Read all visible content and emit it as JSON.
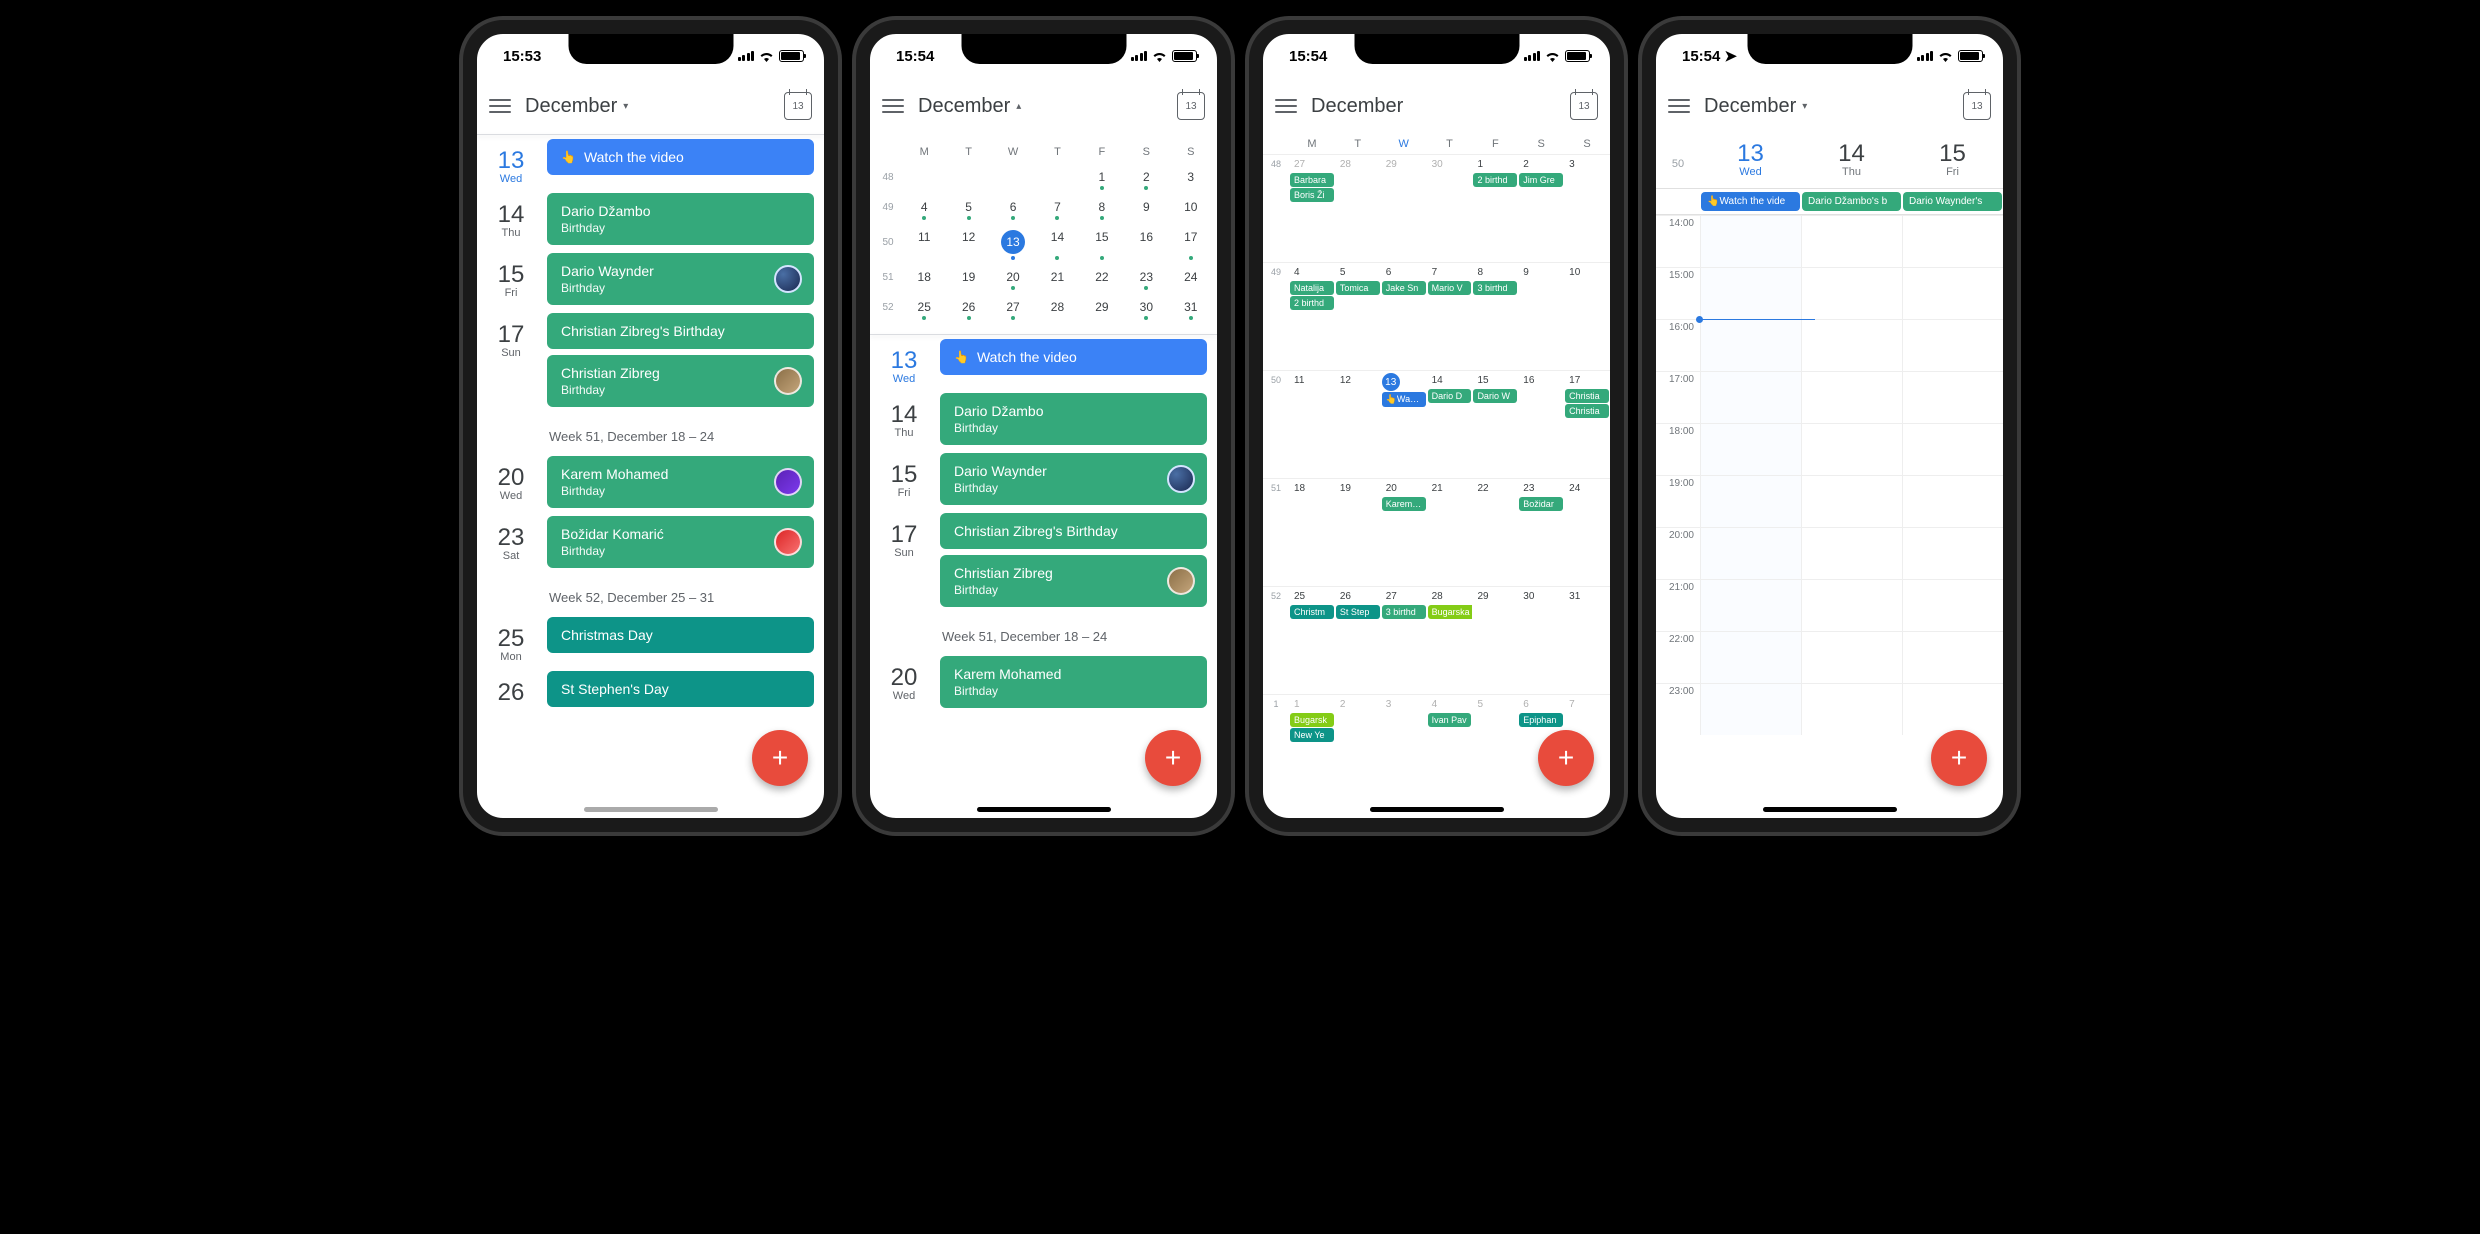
{
  "colors": {
    "accent_blue": "#2b79e0",
    "event_green": "#34a97b",
    "event_teal": "#0d9488",
    "fab": "#e84b3c"
  },
  "p1": {
    "time": "15:53",
    "month": "December",
    "arrow": "▾",
    "today_num": "13",
    "rows": [
      {
        "num": "13",
        "day": "Wed",
        "today": true,
        "events": [
          {
            "type": "blue",
            "title": "Watch the video"
          }
        ]
      },
      {
        "num": "14",
        "day": "Thu",
        "events": [
          {
            "type": "green",
            "title": "Dario Džambo",
            "sub": "Birthday"
          }
        ]
      },
      {
        "num": "15",
        "day": "Fri",
        "events": [
          {
            "type": "green",
            "title": "Dario Waynder",
            "sub": "Birthday",
            "avatar": "ring"
          }
        ]
      },
      {
        "num": "17",
        "day": "Sun",
        "events": [
          {
            "type": "green",
            "title": "Christian Zibreg's Birthday"
          },
          {
            "type": "green",
            "title": "Christian Zibreg",
            "sub": "Birthday",
            "avatar": "photo1"
          }
        ]
      },
      {
        "header": "Week 51, December 18 – 24"
      },
      {
        "num": "20",
        "day": "Wed",
        "events": [
          {
            "type": "green",
            "title": "Karem Mohamed",
            "sub": "Birthday",
            "avatar": "photo2"
          }
        ]
      },
      {
        "num": "23",
        "day": "Sat",
        "events": [
          {
            "type": "green",
            "title": "Božidar Komarić",
            "sub": "Birthday",
            "avatar": "photo3"
          }
        ]
      },
      {
        "header": "Week 52, December 25 – 31"
      },
      {
        "num": "25",
        "day": "Mon",
        "events": [
          {
            "type": "teal",
            "title": "Christmas Day"
          }
        ]
      },
      {
        "num": "26",
        "day": "",
        "events": [
          {
            "type": "teal",
            "title": "St Stephen's Day"
          }
        ]
      }
    ]
  },
  "p2": {
    "time": "15:54",
    "month": "December",
    "arrow": "▴",
    "today_num": "13",
    "mini_hdr": [
      "M",
      "T",
      "W",
      "T",
      "F",
      "S",
      "S"
    ],
    "mini_weeks": [
      {
        "wk": "48",
        "days": [
          {
            "n": "",
            "d": []
          },
          {
            "n": "",
            "d": []
          },
          {
            "n": "",
            "d": []
          },
          {
            "n": "",
            "d": []
          },
          {
            "n": "1",
            "d": [
              "g"
            ]
          },
          {
            "n": "2",
            "d": [
              "g"
            ]
          },
          {
            "n": "3",
            "d": []
          }
        ]
      },
      {
        "wk": "49",
        "days": [
          {
            "n": "4",
            "d": [
              "g"
            ]
          },
          {
            "n": "5",
            "d": [
              "g"
            ]
          },
          {
            "n": "6",
            "d": [
              "g"
            ]
          },
          {
            "n": "7",
            "d": [
              "g"
            ]
          },
          {
            "n": "8",
            "d": [
              "g"
            ]
          },
          {
            "n": "9",
            "d": []
          },
          {
            "n": "10",
            "d": []
          }
        ]
      },
      {
        "wk": "50",
        "days": [
          {
            "n": "11",
            "d": []
          },
          {
            "n": "12",
            "d": []
          },
          {
            "n": "13",
            "d": [
              "b"
            ],
            "t": true
          },
          {
            "n": "14",
            "d": [
              "g"
            ]
          },
          {
            "n": "15",
            "d": [
              "g"
            ]
          },
          {
            "n": "16",
            "d": []
          },
          {
            "n": "17",
            "d": [
              "g"
            ]
          }
        ]
      },
      {
        "wk": "51",
        "days": [
          {
            "n": "18",
            "d": []
          },
          {
            "n": "19",
            "d": []
          },
          {
            "n": "20",
            "d": [
              "g"
            ]
          },
          {
            "n": "21",
            "d": []
          },
          {
            "n": "22",
            "d": []
          },
          {
            "n": "23",
            "d": [
              "g"
            ]
          },
          {
            "n": "24",
            "d": []
          }
        ]
      },
      {
        "wk": "52",
        "days": [
          {
            "n": "25",
            "d": [
              "g"
            ]
          },
          {
            "n": "26",
            "d": [
              "g"
            ]
          },
          {
            "n": "27",
            "d": [
              "g"
            ]
          },
          {
            "n": "28",
            "d": []
          },
          {
            "n": "29",
            "d": []
          },
          {
            "n": "30",
            "d": [
              "g"
            ]
          },
          {
            "n": "31",
            "d": [
              "g"
            ]
          }
        ]
      }
    ],
    "rows": [
      {
        "num": "13",
        "day": "Wed",
        "today": true,
        "events": [
          {
            "type": "blue",
            "title": "Watch the video"
          }
        ]
      },
      {
        "num": "14",
        "day": "Thu",
        "events": [
          {
            "type": "green",
            "title": "Dario Džambo",
            "sub": "Birthday"
          }
        ]
      },
      {
        "num": "15",
        "day": "Fri",
        "events": [
          {
            "type": "green",
            "title": "Dario Waynder",
            "sub": "Birthday",
            "avatar": "ring"
          }
        ]
      },
      {
        "num": "17",
        "day": "Sun",
        "events": [
          {
            "type": "green",
            "title": "Christian Zibreg's Birthday"
          },
          {
            "type": "green",
            "title": "Christian Zibreg",
            "sub": "Birthday",
            "avatar": "photo1"
          }
        ]
      },
      {
        "header": "Week 51, December 18 – 24"
      },
      {
        "num": "20",
        "day": "Wed",
        "events": [
          {
            "type": "green",
            "title": "Karem Mohamed",
            "sub": "Birthday"
          }
        ]
      }
    ]
  },
  "p3": {
    "time": "15:54",
    "month": "December",
    "today_num": "13",
    "hdr": [
      "M",
      "T",
      "W",
      "T",
      "F",
      "S",
      "S"
    ],
    "weeks": [
      {
        "wk": "48",
        "cells": [
          {
            "n": "27",
            "dim": true,
            "chips": [
              {
                "t": "Barbara",
                "c": "g"
              },
              {
                "t": "Boris Ži",
                "c": "g"
              }
            ]
          },
          {
            "n": "28",
            "dim": true
          },
          {
            "n": "29",
            "dim": true
          },
          {
            "n": "30",
            "dim": true
          },
          {
            "n": "1",
            "chips": [
              {
                "t": "2 birthd",
                "c": "g"
              }
            ]
          },
          {
            "n": "2",
            "chips": [
              {
                "t": "Jim Gre",
                "c": "g"
              }
            ]
          },
          {
            "n": "3"
          }
        ]
      },
      {
        "wk": "49",
        "cells": [
          {
            "n": "4",
            "chips": [
              {
                "t": "Natalija",
                "c": "g"
              },
              {
                "t": "2 birthd",
                "c": "g"
              }
            ]
          },
          {
            "n": "5",
            "chips": [
              {
                "t": "Tomica",
                "c": "g"
              }
            ]
          },
          {
            "n": "6",
            "chips": [
              {
                "t": "Jake Sn",
                "c": "g"
              }
            ]
          },
          {
            "n": "7",
            "chips": [
              {
                "t": "Mario V",
                "c": "g"
              }
            ]
          },
          {
            "n": "8",
            "chips": [
              {
                "t": "3 birthd",
                "c": "g"
              }
            ]
          },
          {
            "n": "9"
          },
          {
            "n": "10"
          }
        ]
      },
      {
        "wk": "50",
        "cells": [
          {
            "n": "11"
          },
          {
            "n": "12"
          },
          {
            "n": "13",
            "today": true,
            "chips": [
              {
                "t": "👆Watch",
                "c": "b"
              }
            ]
          },
          {
            "n": "14",
            "chips": [
              {
                "t": "Dario D",
                "c": "g"
              }
            ]
          },
          {
            "n": "15",
            "chips": [
              {
                "t": "Dario W",
                "c": "g"
              }
            ]
          },
          {
            "n": "16"
          },
          {
            "n": "17",
            "chips": [
              {
                "t": "Christia",
                "c": "g"
              },
              {
                "t": "Christia",
                "c": "g"
              }
            ]
          }
        ]
      },
      {
        "wk": "51",
        "cells": [
          {
            "n": "18"
          },
          {
            "n": "19"
          },
          {
            "n": "20",
            "chips": [
              {
                "t": "Karem M",
                "c": "g"
              }
            ]
          },
          {
            "n": "21"
          },
          {
            "n": "22"
          },
          {
            "n": "23",
            "chips": [
              {
                "t": "Božidar",
                "c": "g"
              }
            ]
          },
          {
            "n": "24"
          }
        ]
      },
      {
        "wk": "52",
        "cells": [
          {
            "n": "25",
            "chips": [
              {
                "t": "Christm",
                "c": "t"
              }
            ]
          },
          {
            "n": "26",
            "chips": [
              {
                "t": "St Step",
                "c": "t"
              }
            ]
          },
          {
            "n": "27",
            "chips": [
              {
                "t": "3 birthd",
                "c": "g"
              }
            ]
          },
          {
            "n": "28",
            "span": [
              {
                "t": "Bugarska",
                "c": "l",
                "w": 4
              }
            ]
          },
          {
            "n": "29"
          },
          {
            "n": "30"
          },
          {
            "n": "31"
          }
        ]
      },
      {
        "wk": "1",
        "cells": [
          {
            "n": "1",
            "dim": true,
            "chips": [
              {
                "t": "Bugarsk",
                "c": "l"
              },
              {
                "t": "New Ye",
                "c": "t"
              }
            ]
          },
          {
            "n": "2",
            "dim": true
          },
          {
            "n": "3",
            "dim": true
          },
          {
            "n": "4",
            "dim": true,
            "chips": [
              {
                "t": "Ivan Pav",
                "c": "g"
              }
            ]
          },
          {
            "n": "5",
            "dim": true
          },
          {
            "n": "6",
            "dim": true,
            "chips": [
              {
                "t": "Epiphan",
                "c": "t"
              }
            ]
          },
          {
            "n": "7",
            "dim": true
          }
        ]
      }
    ]
  },
  "p4": {
    "time": "15:54",
    "loc": true,
    "month": "December",
    "arrow": "▾",
    "today_num": "13",
    "wk": "50",
    "days": [
      {
        "num": "13",
        "name": "Wed",
        "today": true,
        "allday": {
          "t": "👆Watch the vide",
          "c": "b"
        }
      },
      {
        "num": "14",
        "name": "Thu",
        "allday": {
          "t": "Dario Džambo's b",
          "c": "g"
        }
      },
      {
        "num": "15",
        "name": "Fri",
        "allday": {
          "t": "Dario Waynder's",
          "c": "g"
        }
      }
    ],
    "hours": [
      "14:00",
      "15:00",
      "16:00",
      "17:00",
      "18:00",
      "19:00",
      "20:00",
      "21:00",
      "22:00",
      "23:00"
    ],
    "now_idx": 2.0
  }
}
